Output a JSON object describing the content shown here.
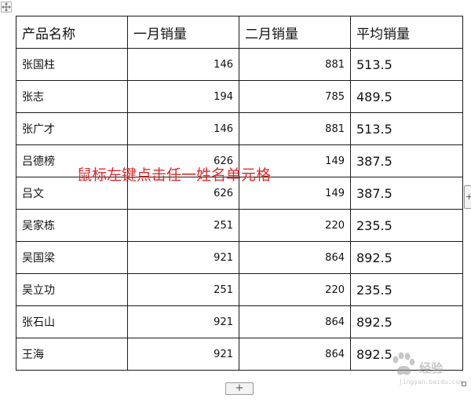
{
  "table": {
    "headers": [
      "产品名称",
      "一月销量",
      "二月销量",
      "平均销量"
    ],
    "rows": [
      {
        "name": "张国柱",
        "jan": "146",
        "feb": "881",
        "avg": "513.5"
      },
      {
        "name": "张志",
        "jan": "194",
        "feb": "785",
        "avg": "489.5"
      },
      {
        "name": "张广才",
        "jan": "146",
        "feb": "881",
        "avg": "513.5"
      },
      {
        "name": "吕德榜",
        "jan": "626",
        "feb": "149",
        "avg": "387.5"
      },
      {
        "name": "吕文",
        "jan": "626",
        "feb": "149",
        "avg": "387.5"
      },
      {
        "name": "吴家栋",
        "jan": "251",
        "feb": "220",
        "avg": "235.5"
      },
      {
        "name": "吴国梁",
        "jan": "921",
        "feb": "864",
        "avg": "892.5"
      },
      {
        "name": "吴立功",
        "jan": "251",
        "feb": "220",
        "avg": "235.5"
      },
      {
        "name": "张石山",
        "jan": "921",
        "feb": "864",
        "avg": "892.5"
      },
      {
        "name": "王海",
        "jan": "921",
        "feb": "864",
        "avg": "892.5"
      }
    ]
  },
  "instruction": "鼠标左键点击任一姓名单元格",
  "controls": {
    "add_row_label": "+",
    "add_col_label": "+"
  },
  "watermark": {
    "text": "经验",
    "sub": "jingyan.baidu.com"
  },
  "icons": {
    "move_handle": "move-arrows-icon",
    "watermark_logo": "paw-icon"
  }
}
